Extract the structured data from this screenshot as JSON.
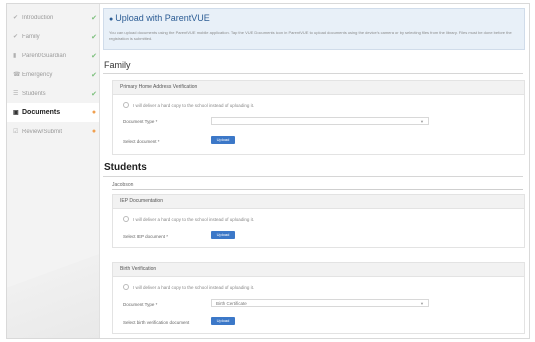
{
  "sidebar": {
    "items": [
      {
        "icon": "✔",
        "label": "Introduction",
        "status": "✔",
        "status_color": "ok"
      },
      {
        "icon": "✔",
        "label": "Family",
        "status": "✔",
        "status_color": "ok"
      },
      {
        "icon": "▮",
        "label": "Parent/Guardian",
        "status": "✔",
        "status_color": "ok"
      },
      {
        "icon": "☎",
        "label": "Emergency",
        "status": "✔",
        "status_color": "ok"
      },
      {
        "icon": "☰",
        "label": "Students",
        "status": "✔",
        "status_color": "ok"
      },
      {
        "icon": "▣",
        "label": "Documents",
        "status": "●",
        "status_color": "warn"
      },
      {
        "icon": "☑",
        "label": "Review/Submit",
        "status": "●",
        "status_color": "warn"
      }
    ]
  },
  "banner": {
    "title": "Upload with ParentVUE",
    "text": "You can upload documents using the ParentVUE mobile application. Tap the VUE Documents icon in ParentVUE to upload documents using the device's camera or by selecting files from the library. Files must be done before the registration is submitted."
  },
  "family": {
    "heading": "Family",
    "panel_title": "Primary Home Address Verification",
    "checkbox": "I will deliver a hard copy to the school instead of uploading it.",
    "doc_type_label": "Document Type *",
    "doc_type_value": "",
    "select_doc_label": "Select document *",
    "upload_label": "Upload"
  },
  "students": {
    "heading": "Students",
    "student_tab": "Jacobson",
    "iep": {
      "title": "IEP Documentation",
      "checkbox": "I will deliver a hard copy to the school instead of uploading it.",
      "select_label": "Select IEP document *",
      "upload_label": "Upload"
    },
    "birth": {
      "title": "Birth Verification",
      "checkbox": "I will deliver a hard copy to the school instead of uploading it.",
      "doc_type_label": "Document Type *",
      "doc_type_value": "Birth Certificate",
      "select_label": "Select birth verification document",
      "upload_label": "Upload"
    }
  },
  "colors": {
    "ok": "#7bbf7b",
    "warn": "#f0a050",
    "accent": "#3c78c8",
    "banner_bg": "#e8f0f8"
  }
}
